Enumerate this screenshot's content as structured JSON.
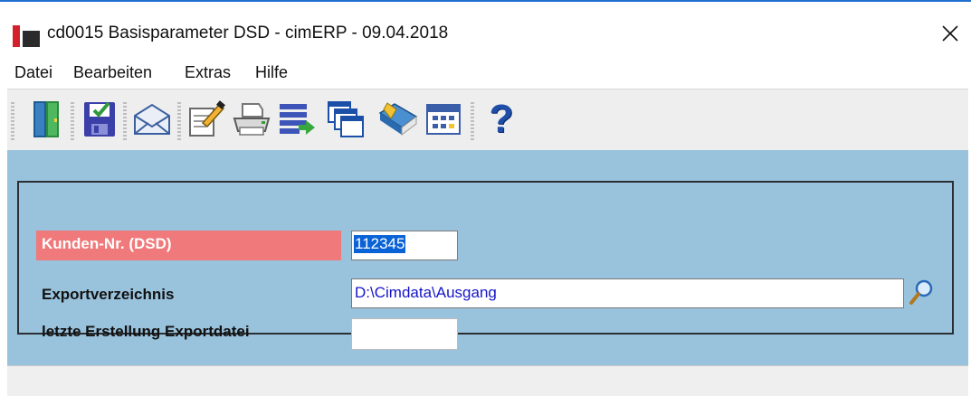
{
  "window": {
    "title": "cd0015 Basisparameter DSD - cimERP - 09.04.2018",
    "close_icon": "close-x-icon"
  },
  "menu": [
    "Datei",
    "Bearbeiten",
    "Extras",
    "Hilfe"
  ],
  "toolbar": {
    "buttons": [
      {
        "icon": "exit-door-icon"
      },
      {
        "icon": "save-disk-icon"
      },
      {
        "icon": "mail-envelope-icon"
      },
      {
        "icon": "edit-notepad-icon"
      },
      {
        "icon": "printer-icon"
      },
      {
        "icon": "list-export-icon"
      },
      {
        "icon": "windows-stack-icon"
      },
      {
        "icon": "book-tag-icon"
      },
      {
        "icon": "calendar-grid-icon"
      },
      {
        "icon": "help-icon"
      }
    ],
    "help_glyph": "?"
  },
  "form": {
    "customer_no": {
      "label": "Kunden-Nr. (DSD)",
      "value": "112345"
    },
    "export_dir": {
      "label": "Exportverzeichnis",
      "value": "D:\\Cimdata\\Ausgang"
    },
    "last_export": {
      "label": "letzte Erstellung Exportdatei",
      "value": ""
    }
  },
  "colors": {
    "client_bg": "#99c2dc",
    "required_label_bg": "#f0797b",
    "selection": "#0a63d6",
    "input_text": "#1515c8"
  }
}
